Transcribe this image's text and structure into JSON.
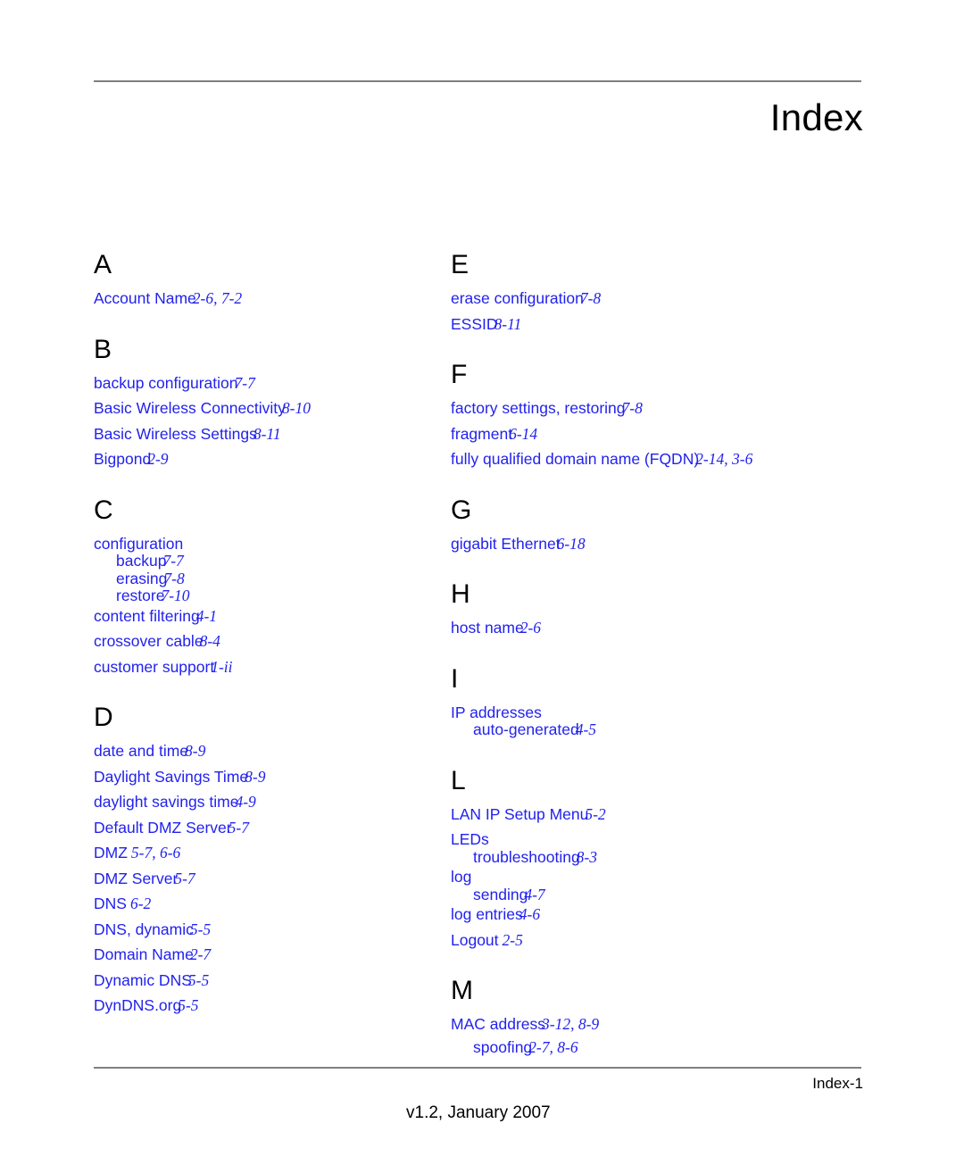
{
  "header": {
    "title": "Index"
  },
  "footer": {
    "page_number": "Index-1",
    "version": "v1.2, January 2007"
  },
  "colors": {
    "entry_blue": "#2222ee",
    "heading_black": "#000000",
    "rule_gray": "#808080"
  },
  "columns": [
    {
      "name": "left-column",
      "groups": [
        {
          "letter": "A",
          "entries": [
            {
              "term": "Account Name",
              "pages": "2-6, 7-2",
              "level": 0
            }
          ]
        },
        {
          "letter": "B",
          "entries": [
            {
              "term": "backup configuration",
              "pages": "7-7",
              "level": 0
            },
            {
              "term": "Basic Wireless Connectivity",
              "pages": "8-10",
              "level": 0
            },
            {
              "term": "Basic Wireless Settings",
              "pages": "8-11",
              "level": 0
            },
            {
              "term": "Bigpond",
              "pages": "2-9",
              "level": 0
            }
          ]
        },
        {
          "letter": "C",
          "entries": [
            {
              "term": "configuration",
              "pages": "",
              "level": 0
            },
            {
              "term": "backup",
              "pages": "7-7",
              "level": 1
            },
            {
              "term": "erasing",
              "pages": "7-8",
              "level": 1
            },
            {
              "term": "restore",
              "pages": "7-10",
              "level": 1
            },
            {
              "term": "content filtering",
              "pages": "4-1",
              "level": 0
            },
            {
              "term": "crossover cable",
              "pages": "8-4",
              "level": 0
            },
            {
              "term": "customer support",
              "pages": "1-ii",
              "level": 0
            }
          ]
        },
        {
          "letter": "D",
          "entries": [
            {
              "term": "date and time",
              "pages": "8-9",
              "level": 0
            },
            {
              "term": "Daylight Savings Time",
              "pages": "8-9",
              "level": 0
            },
            {
              "term": "daylight savings time",
              "pages": "4-9",
              "level": 0
            },
            {
              "term": "Default DMZ Server",
              "pages": "5-7",
              "level": 0
            },
            {
              "term": "DMZ",
              "pages": "5-7, 6-6",
              "level": 0,
              "spaced": true
            },
            {
              "term": "DMZ Server",
              "pages": "5-7",
              "level": 0
            },
            {
              "term": "DNS",
              "pages": "6-2",
              "level": 0,
              "spaced": true
            },
            {
              "term": "DNS, dynamic",
              "pages": "5-5",
              "level": 0
            },
            {
              "term": "Domain Name",
              "pages": "2-7",
              "level": 0
            },
            {
              "term": "Dynamic DNS",
              "pages": "5-5",
              "level": 0
            },
            {
              "term": "DynDNS.org",
              "pages": "5-5",
              "level": 0
            }
          ]
        }
      ]
    },
    {
      "name": "right-column",
      "groups": [
        {
          "letter": "E",
          "entries": [
            {
              "term": "erase configuration",
              "pages": "7-8",
              "level": 0
            },
            {
              "term": "ESSID",
              "pages": "8-11",
              "level": 0
            }
          ]
        },
        {
          "letter": "F",
          "entries": [
            {
              "term": "factory settings, restoring",
              "pages": "7-8",
              "level": 0
            },
            {
              "term": "fragment",
              "pages": "6-14",
              "level": 0
            },
            {
              "term": "fully qualified domain name (FQDN)",
              "pages": "2-14, 3-6",
              "level": 0
            }
          ]
        },
        {
          "letter": "G",
          "entries": [
            {
              "term": "gigabit Ethernet",
              "pages": "6-18",
              "level": 0
            }
          ]
        },
        {
          "letter": "H",
          "entries": [
            {
              "term": "host name",
              "pages": "2-6",
              "level": 0
            }
          ]
        },
        {
          "letter": "I",
          "entries": [
            {
              "term": "IP addresses",
              "pages": "",
              "level": 0
            },
            {
              "term": "auto-generated",
              "pages": "4-5",
              "level": 1
            }
          ]
        },
        {
          "letter": "L",
          "entries": [
            {
              "term": "LAN IP Setup Menu",
              "pages": "5-2",
              "level": 0
            },
            {
              "term": "LEDs",
              "pages": "",
              "level": 0
            },
            {
              "term": "troubleshooting",
              "pages": "8-3",
              "level": 1
            },
            {
              "term": "log",
              "pages": "",
              "level": 0
            },
            {
              "term": "sending",
              "pages": "4-7",
              "level": 1
            },
            {
              "term": "log entries",
              "pages": "4-6",
              "level": 0
            },
            {
              "term": "Logout",
              "pages": "2-5",
              "level": 0,
              "spaced": true
            }
          ]
        },
        {
          "letter": "M",
          "entries": [
            {
              "term": "MAC address",
              "pages": "3-12, 8-9",
              "level": 0
            },
            {
              "term": "spoofing",
              "pages": "2-7, 8-6",
              "level": 1
            }
          ]
        }
      ]
    }
  ]
}
